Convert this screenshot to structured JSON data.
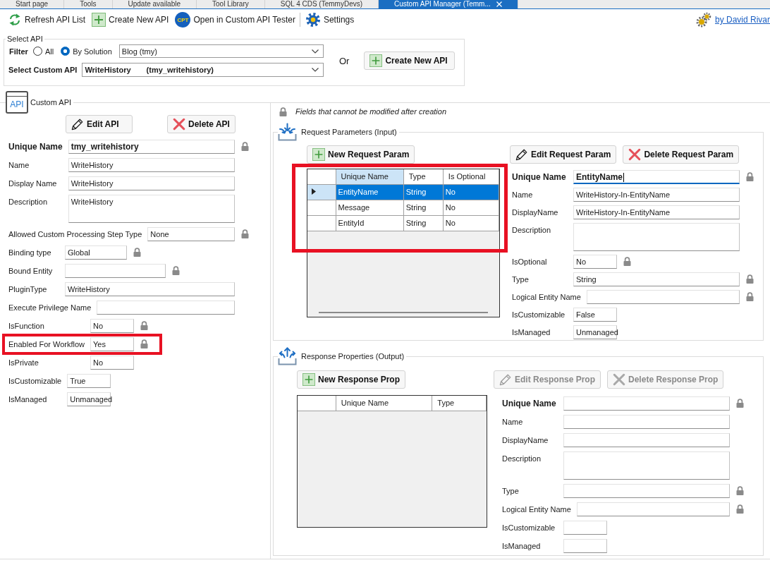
{
  "tabs": [
    {
      "label": "Start page",
      "selected": false
    },
    {
      "label": "Tools",
      "selected": false
    },
    {
      "label": "Update available",
      "selected": false
    },
    {
      "label": "Tool Library",
      "selected": false
    },
    {
      "label": "SQL 4 CDS (TemmyDevs)",
      "selected": false
    },
    {
      "label": "Custom API Manager (Temm...",
      "selected": true
    }
  ],
  "toolbar": {
    "items": [
      {
        "kind": "button",
        "label": "Refresh API List"
      },
      {
        "kind": "button",
        "label": "Create New API"
      },
      {
        "kind": "button",
        "label": "Open in Custom API Tester",
        "icon_text": "CPT"
      },
      {
        "kind": "separator"
      },
      {
        "kind": "button",
        "label": "Settings"
      }
    ],
    "author_link": "by David Rivar"
  },
  "select_api": {
    "legend": "Select API",
    "filter": {
      "label": "Filter",
      "options": [
        {
          "label": "All",
          "selected": false
        },
        {
          "label": "By Solution",
          "selected": true
        }
      ],
      "value": "Blog (tmy)"
    },
    "custom_api": {
      "label": "Select Custom API",
      "name": "WriteHistory",
      "unique_name": "(tmy_writehistory)"
    },
    "or_label": "Or",
    "create_button": "Create New API"
  },
  "custom_api": {
    "legend": "Custom API",
    "icon_label": "API",
    "buttons": [
      {
        "kind": "edit",
        "label": "Edit API",
        "disabled": false
      },
      {
        "kind": "delete",
        "label": "Delete API",
        "disabled": false
      }
    ],
    "field_groups": [
      {
        "fields": [
          {
            "label": "Unique Name",
            "value": "tmy_writehistory",
            "kind": "key",
            "locked": true,
            "highlighted": false
          },
          {
            "label": "Name",
            "value": "WriteHistory",
            "kind": "text",
            "locked": false,
            "highlighted": false
          },
          {
            "label": "Display Name",
            "value": "WriteHistory",
            "kind": "text",
            "locked": false,
            "highlighted": false
          },
          {
            "label": "Description",
            "value": "WriteHistory",
            "kind": "multiline",
            "locked": false,
            "highlighted": false
          }
        ]
      },
      {
        "fields": [
          {
            "label": "Allowed Custom Processing Step Type",
            "value": "None",
            "kind": "text",
            "locked": true,
            "highlighted": false
          }
        ]
      },
      {
        "fields": [
          {
            "label": "Binding type",
            "value": "Global",
            "kind": "medium",
            "locked": true,
            "highlighted": false
          },
          {
            "label": "Bound Entity",
            "kind": "long",
            "locked": true,
            "highlighted": false
          },
          {
            "label": "PluginType",
            "value": "WriteHistory",
            "kind": "text",
            "locked": false,
            "highlighted": false
          }
        ]
      },
      {
        "fields": [
          {
            "label": "Execute Privilege Name",
            "kind": "text",
            "locked": false,
            "highlighted": false
          }
        ]
      },
      {
        "fields": [
          {
            "label": "IsFunction",
            "value": "No",
            "kind": "short",
            "locked": true,
            "highlighted": false
          },
          {
            "label": "Enabled For Workflow",
            "value": "Yes",
            "kind": "short",
            "locked": true,
            "highlighted": true
          },
          {
            "label": "IsPrivate",
            "value": "No",
            "kind": "short",
            "locked": false,
            "highlighted": false
          }
        ]
      },
      {
        "fields": [
          {
            "label": "IsCustomizable",
            "value": "True",
            "kind": "short",
            "locked": false,
            "highlighted": false
          },
          {
            "label": "IsManaged",
            "value": "Unmanaged",
            "kind": "short",
            "locked": false,
            "highlighted": false
          }
        ]
      }
    ]
  },
  "notice": "Fields that cannot be modified after creation",
  "request_parameters": {
    "legend": "Request Parameters (Input)",
    "new_button": "New Request Param",
    "table": {
      "highlighted": true,
      "columns": [
        {
          "label": "Unique Name",
          "selected": true
        },
        {
          "label": "Type",
          "selected": false
        },
        {
          "label": "Is Optional",
          "selected": false
        }
      ],
      "rows": [
        {
          "cells": [
            "EntityName",
            "String",
            "No"
          ],
          "selected": true
        },
        {
          "cells": [
            "Message",
            "String",
            "No"
          ],
          "selected": false
        },
        {
          "cells": [
            "EntityId",
            "String",
            "No"
          ],
          "selected": false
        }
      ]
    },
    "buttons": [
      {
        "kind": "edit",
        "label": "Edit Request Param",
        "disabled": false
      },
      {
        "kind": "delete",
        "label": "Delete Request Param",
        "disabled": false
      }
    ],
    "field_groups": [
      {
        "fields": [
          {
            "label": "Unique Name",
            "value": "EntityName",
            "kind": "key",
            "locked": true,
            "focused": true
          },
          {
            "label": "Name",
            "value": "WriteHistory-In-EntityName",
            "kind": "text",
            "locked": false,
            "focused": false
          },
          {
            "label": "DisplayName",
            "value": "WriteHistory-In-EntityName",
            "kind": "text",
            "locked": false,
            "focused": false
          },
          {
            "label": "Description",
            "kind": "multiline",
            "locked": false,
            "focused": false
          },
          {
            "label": "IsOptional",
            "value": "No",
            "kind": "short",
            "locked": true,
            "focused": false
          },
          {
            "label": "Type",
            "value": "String",
            "kind": "text",
            "locked": true,
            "focused": false
          }
        ]
      },
      {
        "fields": [
          {
            "label": "Logical Entity Name",
            "kind": "text",
            "locked": true,
            "focused": false
          }
        ]
      },
      {
        "fields": [
          {
            "label": "IsCustomizable",
            "value": "False",
            "kind": "short",
            "locked": false,
            "focused": false
          },
          {
            "label": "IsManaged",
            "value": "Unmanaged",
            "kind": "short",
            "locked": false,
            "focused": false
          }
        ]
      }
    ]
  },
  "response_properties": {
    "legend": "Response Properties (Output)",
    "new_button": "New Response Prop",
    "table": {
      "highlighted": false,
      "columns": [
        {
          "label": "Unique Name",
          "selected": false
        },
        {
          "label": "Type",
          "selected": false
        }
      ]
    },
    "buttons": [
      {
        "kind": "edit",
        "label": "Edit Response Prop",
        "disabled": true
      },
      {
        "kind": "delete",
        "label": "Delete Response Prop",
        "disabled": true
      }
    ],
    "field_groups": [
      {
        "fields": [
          {
            "label": "Unique Name",
            "kind": "key",
            "locked": true
          },
          {
            "label": "Name",
            "kind": "text",
            "locked": false
          },
          {
            "label": "DisplayName",
            "kind": "text",
            "locked": false
          },
          {
            "label": "Description",
            "kind": "multiline",
            "locked": false
          },
          {
            "label": "Type",
            "kind": "text",
            "locked": true
          }
        ]
      },
      {
        "fields": [
          {
            "label": "Logical Entity Name",
            "kind": "text",
            "locked": true
          }
        ]
      },
      {
        "fields": [
          {
            "label": "IsCustomizable",
            "kind": "short",
            "locked": false
          },
          {
            "label": "IsManaged",
            "kind": "short",
            "locked": false
          }
        ]
      }
    ]
  }
}
